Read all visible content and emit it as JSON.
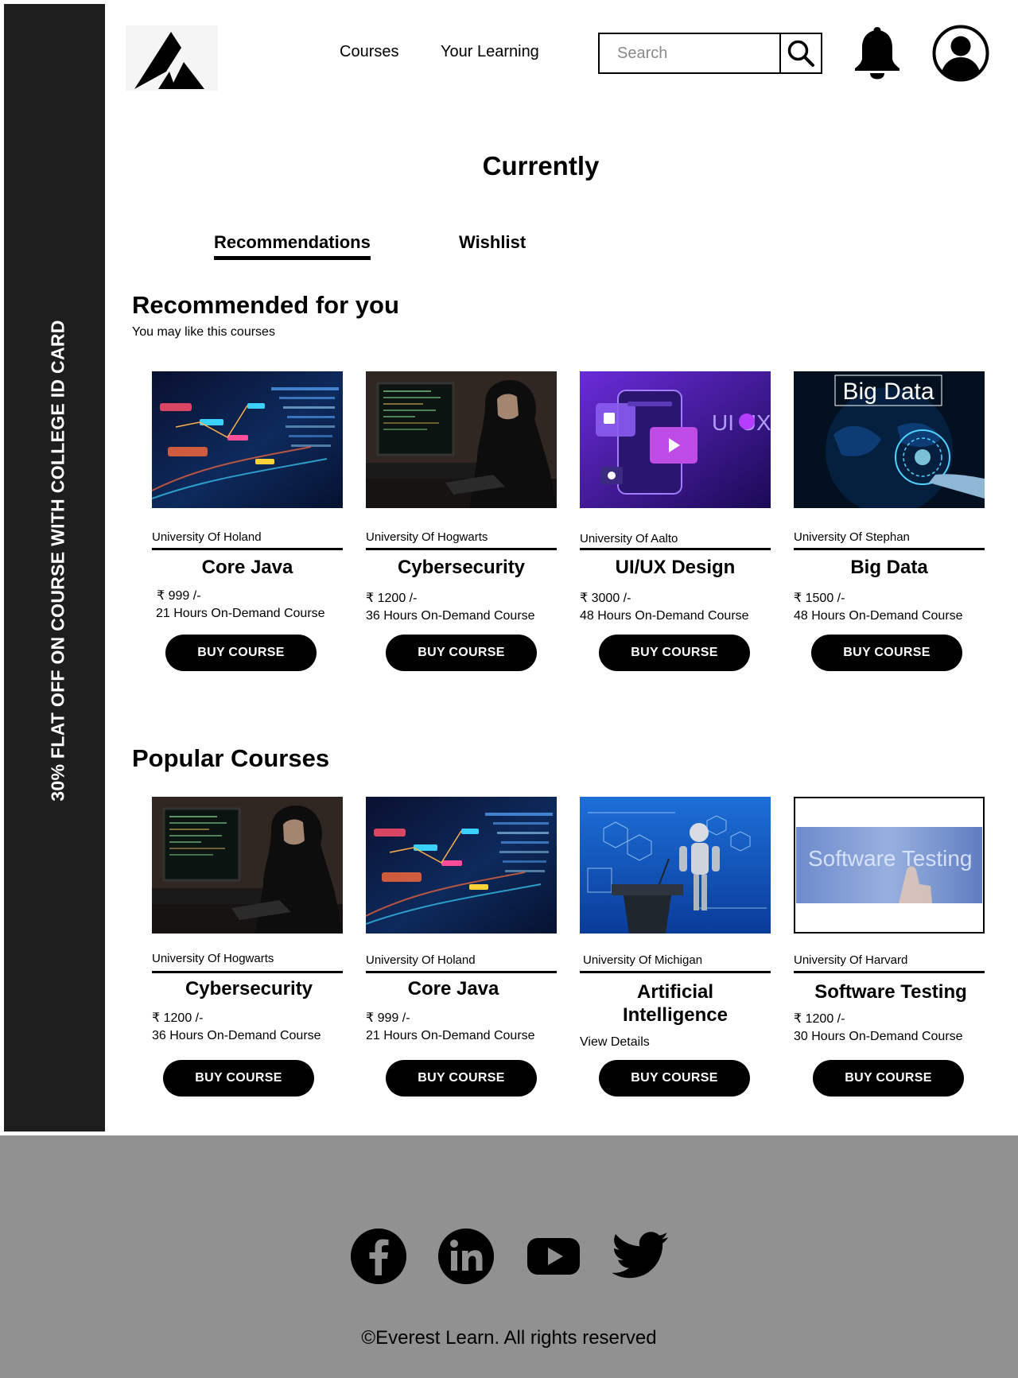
{
  "promo_banner": {
    "text": "30% FLAT OFF ON COURSE WITH COLLEGE ID CARD"
  },
  "header": {
    "nav": {
      "courses": "Courses",
      "your_learning": "Your Learning"
    },
    "search": {
      "placeholder": "Search"
    },
    "icons": {
      "logo": "mountain-logo",
      "search": "search-icon",
      "notifications": "bell-icon",
      "profile": "user-avatar-icon"
    }
  },
  "page_title": "Currently",
  "tabs": {
    "recommendations": "Recommendations",
    "wishlist": "Wishlist",
    "active": "Recommendations"
  },
  "recommended": {
    "title": "Recommended for you",
    "subtitle": "You may like this courses",
    "courses": [
      {
        "university": "University Of Holand",
        "title": "Core Java",
        "price": "₹ 999 /-",
        "hours": "21 Hours On-Demand Course",
        "button": "BUY COURSE",
        "image": "code-visualization-image"
      },
      {
        "university": "University Of Hogwarts",
        "title": "Cybersecurity",
        "price": "₹ 1200 /-",
        "hours": "36 Hours On-Demand Course",
        "button": "BUY COURSE",
        "image": "hooded-hacker-image"
      },
      {
        "university": "University Of Aalto",
        "title": "UI/UX Design",
        "price": "₹ 3000 /-",
        "hours": "48 Hours On-Demand Course",
        "button": "BUY COURSE",
        "image": "ui-ux-mockup-image",
        "image_text": "UI UX"
      },
      {
        "university": "University Of Stephan",
        "title": "Big Data",
        "price": "₹ 1500 /-",
        "hours": "48 Hours On-Demand Course",
        "button": "BUY COURSE",
        "image": "big-data-globe-image",
        "image_text": "Big Data"
      }
    ]
  },
  "popular": {
    "title": "Popular Courses",
    "courses": [
      {
        "university": "University Of Hogwarts",
        "title": "Cybersecurity",
        "price": "₹ 1200 /-",
        "hours": "36 Hours On-Demand Course",
        "button": "BUY COURSE",
        "image": "hooded-hacker-image"
      },
      {
        "university": "University Of Holand",
        "title": "Core Java",
        "price": "₹ 999 /-",
        "hours": "21 Hours On-Demand Course",
        "button": "BUY COURSE",
        "image": "code-visualization-image"
      },
      {
        "university": "University Of Michigan",
        "title_line1": "Artificial",
        "title_line2": "Intelligence",
        "details": "View Details",
        "button": "BUY COURSE",
        "image": "robot-lecture-image"
      },
      {
        "university": "University Of Harvard",
        "title": "Software Testing",
        "price": "₹ 1200 /-",
        "hours": "30 Hours On-Demand Course",
        "button": "BUY COURSE",
        "image": "software-testing-image",
        "image_text": "Software Testing"
      }
    ]
  },
  "footer": {
    "social": [
      "facebook-icon",
      "linkedin-icon",
      "youtube-icon",
      "twitter-icon"
    ],
    "copyright": "©Everest Learn. All rights reserved"
  },
  "colors": {
    "banner": "#1e1e1e",
    "footer": "#919191",
    "button": "#000000",
    "button_text": "#ffffff"
  }
}
